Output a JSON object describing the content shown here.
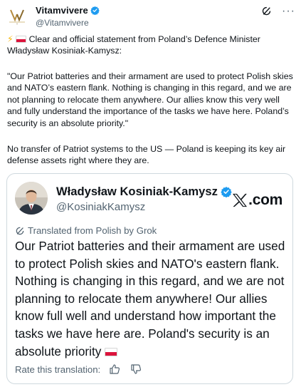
{
  "post": {
    "author_name": "Vitamvivere",
    "author_handle": "@Vitamvivere",
    "line1": "Clear and official statement from Poland’s Defence Minister Władysław Kosiniak-Kamysz:",
    "quote": "\"Our Patriot batteries and their armament are used to protect Polish skies and NATO’s eastern flank. Nothing is changing in this regard, and we are not planning to relocate them anywhere. Our allies know this very well and fully understand the importance of the tasks we have here. Poland’s security is an absolute priority.\"",
    "closing": "No transfer of Patriot systems to the US — Poland is keeping its key air defense assets right where they are.",
    "more_label": "···",
    "icons": [
      "lightning-emoji",
      "poland-flag-emoji",
      "grok-icon",
      "more-icon",
      "verified-badge-icon"
    ]
  },
  "quoted": {
    "author_name": "Władysław Kosiniak-Kamysz",
    "author_handle": "@KosiniakKamysz",
    "source_brand": ".com",
    "translated_label": "Translated from Polish by Grok",
    "text": "Our Patriot batteries and their armament are used to protect Polish skies and NATO's eastern flank. Nothing is changing in this regard, and we are not planning to relocate them anywhere! Our allies know full well and understand how important the tasks we have here are. Poland's security is an absolute priority",
    "rate_label": "Rate this translation:",
    "icons": [
      "x-logo-icon",
      "thumbs-up-icon",
      "thumbs-down-icon",
      "translate-icon"
    ]
  },
  "colors": {
    "text": "#0f1419",
    "secondary": "#536471",
    "verified": "#1d9bf0",
    "border": "#cfd9de",
    "flag_red": "#dc143c"
  }
}
